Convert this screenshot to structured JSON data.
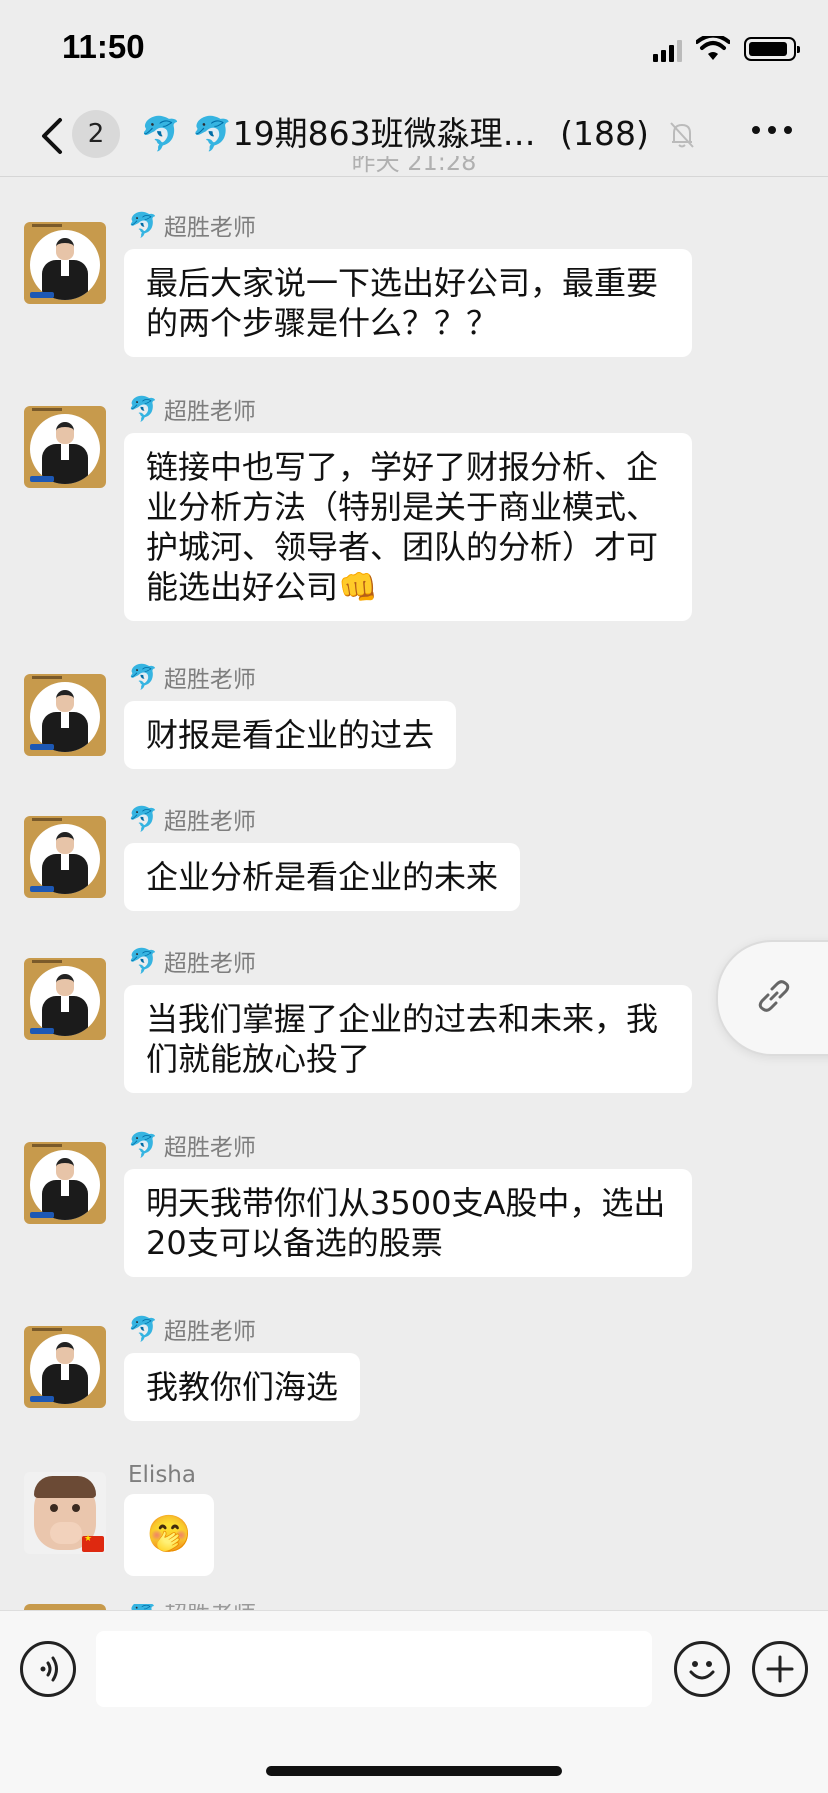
{
  "status_bar": {
    "time": "11:50"
  },
  "nav": {
    "unread_count": "2",
    "title": "🐬 🐬19期863班微淼理…",
    "member_count": "(188)"
  },
  "messages": [
    {
      "sender": "超胜老师",
      "text": "最后大家说一下选出好公司，最重要的两个步骤是什么？？？"
    },
    {
      "sender": "超胜老师",
      "text": "链接中也写了，学好了财报分析、企业分析方法（特别是关于商业模式、护城河、领导者、团队的分析）才可能选出好公司👊"
    },
    {
      "sender": "超胜老师",
      "text": "财报是看企业的过去"
    },
    {
      "sender": "超胜老师",
      "text": "企业分析是看企业的未来"
    },
    {
      "sender": "超胜老师",
      "text": "当我们掌握了企业的过去和未来，我们就能放心投了"
    },
    {
      "sender": "超胜老师",
      "text": "明天我带你们从3500支A股中，选出20支可以备选的股票"
    },
    {
      "sender": "超胜老师",
      "text": "我教你们海选"
    },
    {
      "sender": "Elisha",
      "text": "🤭"
    }
  ],
  "icons": {
    "sender_prefix": "🐬",
    "back": "chevron-left-icon",
    "mute": "bell-slash-icon",
    "more": "ellipsis-icon",
    "link": "link-icon",
    "voice": "voice-icon",
    "emoji": "smiley-icon",
    "plus": "plus-icon"
  },
  "colors": {
    "background": "#ededed",
    "bubble": "#ffffff",
    "sender_name": "#7e7e7e"
  }
}
